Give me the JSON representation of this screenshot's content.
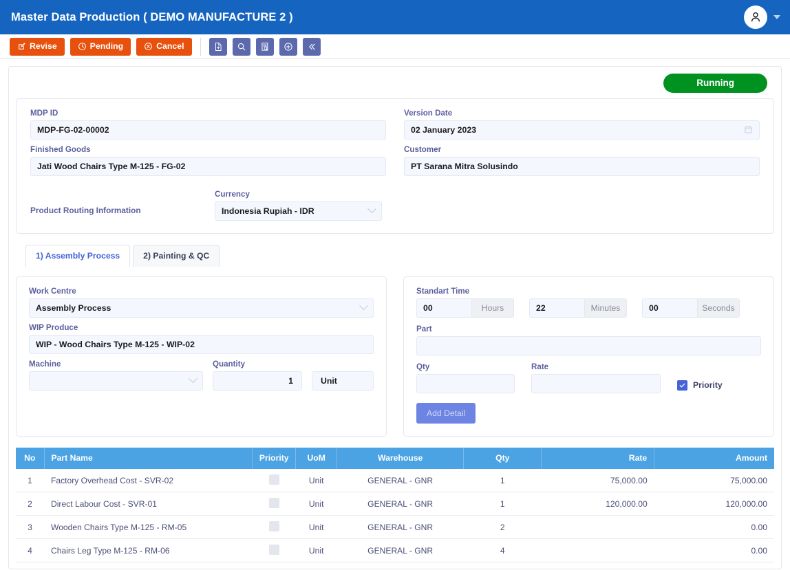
{
  "header": {
    "title": "Master Data Production ( DEMO MANUFACTURE 2 )",
    "avatar_icon": "user-icon",
    "caret_icon": "caret-down-icon"
  },
  "toolbar": {
    "actions": [
      {
        "label": "Revise",
        "icon": "edit-square-icon"
      },
      {
        "label": "Pending",
        "icon": "clock-icon"
      },
      {
        "label": "Cancel",
        "icon": "circle-x-icon"
      }
    ],
    "icon_buttons": [
      {
        "name": "new-document-icon"
      },
      {
        "name": "search-icon"
      },
      {
        "name": "document-search-icon"
      },
      {
        "name": "circle-plus-icon"
      },
      {
        "name": "double-chevron-left-icon"
      }
    ],
    "accent_orange": "#E8500E",
    "icon_button_color": "#5C6AAD"
  },
  "status": {
    "badge_label": "Running",
    "badge_color": "#009220"
  },
  "info": {
    "mdp_id_label": "MDP ID",
    "mdp_id_value": "MDP-FG-02-00002",
    "version_date_label": "Version Date",
    "version_date_value": "02 January 2023",
    "version_date_icon": "calendar-icon",
    "finished_goods_label": "Finished Goods",
    "finished_goods_value": "Jati Wood Chairs  Type M-125 - FG-02",
    "customer_label": "Customer",
    "customer_value": "PT Sarana Mitra Solusindo",
    "routing_label": "Product Routing Information",
    "currency_label": "Currency",
    "currency_value": "Indonesia Rupiah - IDR"
  },
  "tabs": [
    {
      "label": "1) Assembly Process",
      "active": true
    },
    {
      "label": "2) Painting & QC",
      "active": false
    }
  ],
  "left_form": {
    "work_centre_label": "Work Centre",
    "work_centre_value": "Assembly Process",
    "wip_produce_label": "WIP Produce",
    "wip_produce_value": "WIP - Wood Chairs Type M-125 - WIP-02",
    "machine_label": "Machine",
    "machine_value": "",
    "quantity_label": "Quantity",
    "quantity_value": "1",
    "unit_value": "Unit"
  },
  "right_form": {
    "standart_time_label": "Standart Time",
    "hours_value": "00",
    "hours_addon": "Hours",
    "minutes_value": "22",
    "minutes_addon": "Minutes",
    "seconds_value": "00",
    "seconds_addon": "Seconds",
    "part_label": "Part",
    "part_value": "",
    "qty_label": "Qty",
    "qty_value": "",
    "rate_label": "Rate",
    "rate_value": "",
    "priority_label": "Priority",
    "priority_checked": true,
    "add_detail_label": "Add Detail"
  },
  "table": {
    "columns": [
      "No",
      "Part Name",
      "Priority",
      "UoM",
      "Warehouse",
      "Qty",
      "Rate",
      "Amount"
    ],
    "rows": [
      {
        "no": "1",
        "part_name": "Factory Overhead Cost - SVR-02",
        "priority": false,
        "uom": "Unit",
        "warehouse": "GENERAL - GNR",
        "qty": "1",
        "rate": "75,000.00",
        "amount": "75,000.00"
      },
      {
        "no": "2",
        "part_name": "Direct Labour Cost - SVR-01",
        "priority": false,
        "uom": "Unit",
        "warehouse": "GENERAL - GNR",
        "qty": "1",
        "rate": "120,000.00",
        "amount": "120,000.00"
      },
      {
        "no": "3",
        "part_name": "Wooden Chairs Type M-125 - RM-05",
        "priority": false,
        "uom": "Unit",
        "warehouse": "GENERAL - GNR",
        "qty": "2",
        "rate": "",
        "amount": "0.00"
      },
      {
        "no": "4",
        "part_name": "Chairs Leg Type M-125 - RM-06",
        "priority": false,
        "uom": "Unit",
        "warehouse": "GENERAL - GNR",
        "qty": "4",
        "rate": "",
        "amount": "0.00"
      }
    ],
    "header_color": "#4BA3E3"
  }
}
